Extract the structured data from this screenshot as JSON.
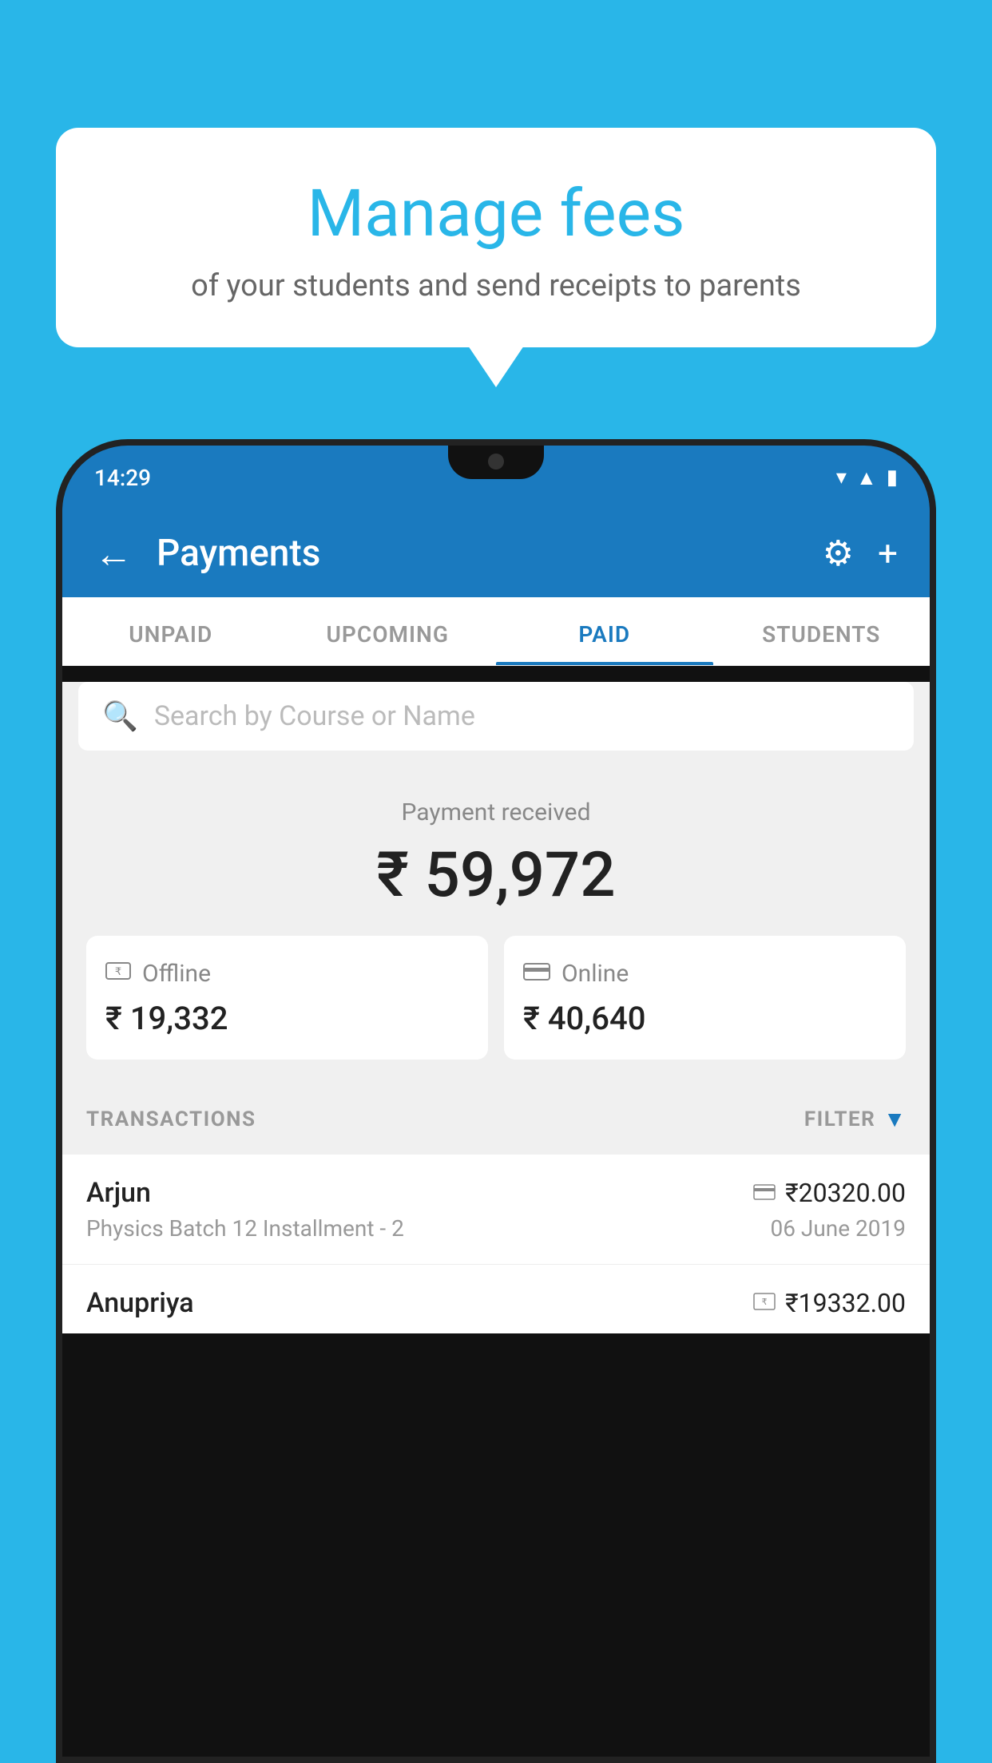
{
  "background_color": "#29b6e8",
  "speech_bubble": {
    "title": "Manage fees",
    "subtitle": "of your students and send receipts to parents"
  },
  "phone": {
    "status_bar": {
      "time": "14:29",
      "wifi_icon": "wifi",
      "signal_icon": "signal",
      "battery_icon": "battery"
    },
    "header": {
      "title": "Payments",
      "back_label": "←",
      "settings_label": "⚙",
      "add_label": "+"
    },
    "tabs": [
      {
        "id": "unpaid",
        "label": "UNPAID",
        "active": false
      },
      {
        "id": "upcoming",
        "label": "UPCOMING",
        "active": false
      },
      {
        "id": "paid",
        "label": "PAID",
        "active": true
      },
      {
        "id": "students",
        "label": "STUDENTS",
        "active": false
      }
    ],
    "search": {
      "placeholder": "Search by Course or Name",
      "icon": "🔍"
    },
    "payment_summary": {
      "label": "Payment received",
      "amount": "₹ 59,972",
      "offline": {
        "label": "Offline",
        "amount": "₹ 19,332",
        "icon": "💳"
      },
      "online": {
        "label": "Online",
        "amount": "₹ 40,640",
        "icon": "💳"
      }
    },
    "transactions": {
      "header_label": "TRANSACTIONS",
      "filter_label": "FILTER",
      "rows": [
        {
          "name": "Arjun",
          "amount": "₹20320.00",
          "detail": "Physics Batch 12 Installment - 2",
          "date": "06 June 2019",
          "payment_type": "online"
        },
        {
          "name": "Anupriya",
          "amount": "₹19332.00",
          "detail": "",
          "date": "",
          "payment_type": "offline"
        }
      ]
    }
  }
}
